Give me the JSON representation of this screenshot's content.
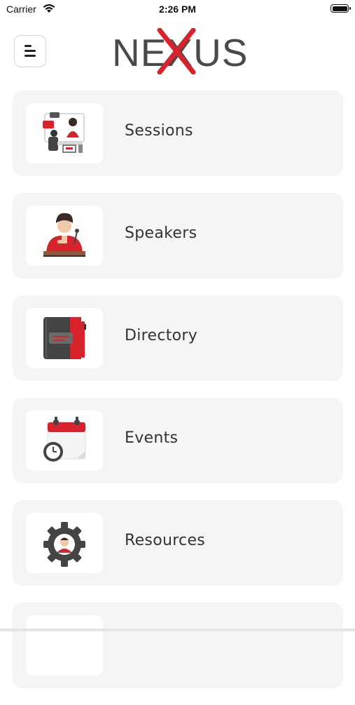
{
  "status_bar": {
    "carrier": "Carrier",
    "time": "2:26 PM"
  },
  "header": {
    "logo_text": "NEXUS",
    "brand_color": "#d7232c"
  },
  "menu": {
    "items": [
      {
        "label": "Sessions",
        "icon": "sessions-icon"
      },
      {
        "label": "Speakers",
        "icon": "speakers-icon"
      },
      {
        "label": "Directory",
        "icon": "directory-icon"
      },
      {
        "label": "Events",
        "icon": "events-icon"
      },
      {
        "label": "Resources",
        "icon": "resources-icon"
      }
    ]
  }
}
